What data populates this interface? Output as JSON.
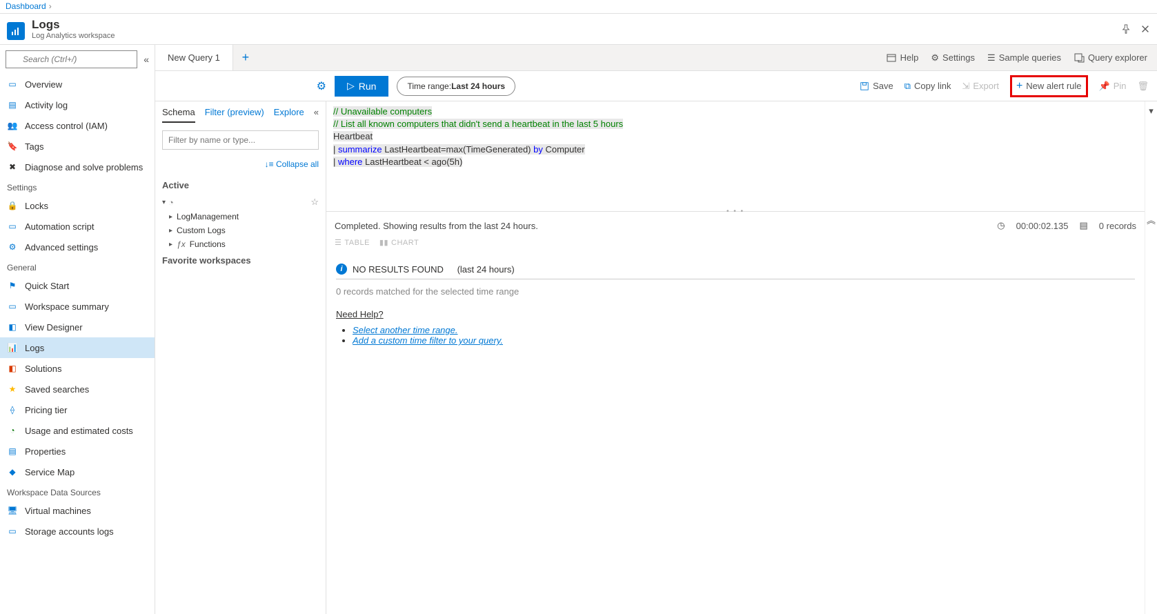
{
  "breadcrumb": {
    "root": "Dashboard"
  },
  "header": {
    "title": "Logs",
    "subtitle": "Log Analytics workspace"
  },
  "search": {
    "placeholder": "Search (Ctrl+/)"
  },
  "nav": {
    "top": [
      {
        "label": "Overview"
      },
      {
        "label": "Activity log"
      },
      {
        "label": "Access control (IAM)"
      },
      {
        "label": "Tags"
      },
      {
        "label": "Diagnose and solve problems"
      }
    ],
    "settings_header": "Settings",
    "settings": [
      {
        "label": "Locks"
      },
      {
        "label": "Automation script"
      },
      {
        "label": "Advanced settings"
      }
    ],
    "general_header": "General",
    "general": [
      {
        "label": "Quick Start"
      },
      {
        "label": "Workspace summary"
      },
      {
        "label": "View Designer"
      },
      {
        "label": "Logs",
        "active": true
      },
      {
        "label": "Solutions"
      },
      {
        "label": "Saved searches"
      },
      {
        "label": "Pricing tier"
      },
      {
        "label": "Usage and estimated costs"
      },
      {
        "label": "Properties"
      },
      {
        "label": "Service Map"
      }
    ],
    "wds_header": "Workspace Data Sources",
    "wds": [
      {
        "label": "Virtual machines"
      },
      {
        "label": "Storage accounts logs"
      }
    ]
  },
  "tabs": {
    "active": "New Query 1"
  },
  "tabbar_right": {
    "help": "Help",
    "settings": "Settings",
    "sample": "Sample queries",
    "explorer": "Query explorer"
  },
  "toolbar": {
    "run": "Run",
    "timerange_prefix": "Time range: ",
    "timerange_value": "Last 24 hours",
    "save": "Save",
    "copy": "Copy link",
    "export": "Export",
    "new_alert": "New alert rule",
    "pin": "Pin"
  },
  "schema": {
    "tabs": {
      "schema": "Schema",
      "filter": "Filter (preview)",
      "explore": "Explore"
    },
    "filter_placeholder": "Filter by name or type...",
    "collapse_all": "Collapse all",
    "active": "Active",
    "tree": [
      {
        "label": "LogManagement"
      },
      {
        "label": "Custom Logs"
      },
      {
        "label": "Functions",
        "italic": true
      }
    ],
    "favorite": "Favorite workspaces"
  },
  "editor": {
    "line1": "// Unavailable computers",
    "line2": "// List all known computers that didn't send a heartbeat in the last 5 hours",
    "line3": "Heartbeat",
    "line4_pipe": "| ",
    "line4_kw": "summarize",
    "line4_rest1": " LastHeartbeat=max(TimeGenerated) ",
    "line4_by": "by",
    "line4_rest2": " Computer",
    "line5_pipe": "| ",
    "line5_kw": "where",
    "line5_rest": " LastHeartbeat < ago(5h)"
  },
  "status": {
    "message": "Completed. Showing results from the last 24 hours.",
    "duration": "00:00:02.135",
    "records": "0 records"
  },
  "view": {
    "table": "TABLE",
    "chart": "CHART"
  },
  "results": {
    "title": "NO RESULTS FOUND",
    "range": "(last 24 hours)",
    "subtitle": "0 records matched for the selected time range",
    "help_header": "Need Help?",
    "tip1": "Select another time range.",
    "tip2": "Add a custom time filter to your query."
  }
}
